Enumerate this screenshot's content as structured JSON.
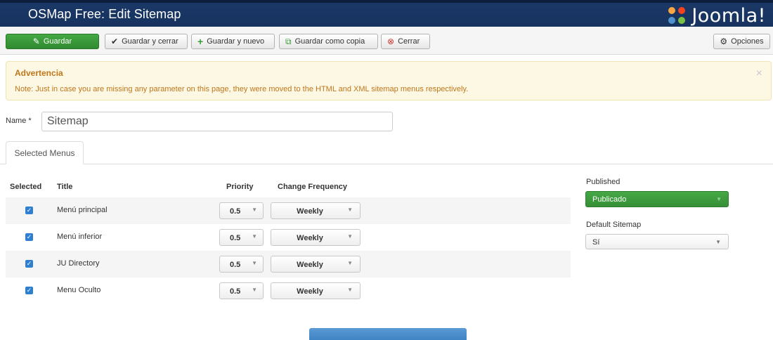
{
  "header": {
    "title": "OSMap Free: Edit Sitemap",
    "logo_text": "Joomla!"
  },
  "toolbar": {
    "save_label": "Guardar",
    "save_close_label": "Guardar y cerrar",
    "save_new_label": "Guardar y nuevo",
    "save_copy_label": "Guardar como copia",
    "close_label": "Cerrar",
    "options_label": "Opciones"
  },
  "alert": {
    "heading": "Advertencia",
    "message": "Note: Just in case you are missing any parameter on this page, they were moved to the HTML and XML sitemap menus respectively.",
    "close": "×"
  },
  "form": {
    "name_label": "Name *",
    "name_value": "Sitemap"
  },
  "tabs": [
    {
      "label": "Selected Menus"
    }
  ],
  "table": {
    "headers": {
      "selected": "Selected",
      "title": "Title",
      "priority": "Priority",
      "frequency": "Change Frequency"
    },
    "rows": [
      {
        "title": "Menú principal",
        "priority": "0.5",
        "frequency": "Weekly",
        "checked": true
      },
      {
        "title": "Menú inferior",
        "priority": "0.5",
        "frequency": "Weekly",
        "checked": true
      },
      {
        "title": "JU Directory",
        "priority": "0.5",
        "frequency": "Weekly",
        "checked": true
      },
      {
        "title": "Menu Oculto",
        "priority": "0.5",
        "frequency": "Weekly",
        "checked": true
      }
    ]
  },
  "sidebar": {
    "published_label": "Published",
    "published_value": "Publicado",
    "default_label": "Default Sitemap",
    "default_value": "Sí"
  },
  "colors": {
    "header_bg": "#17325e",
    "success": "#3c9a3c",
    "alert_text": "#c0761b",
    "checkbox": "#2e7fd0"
  }
}
